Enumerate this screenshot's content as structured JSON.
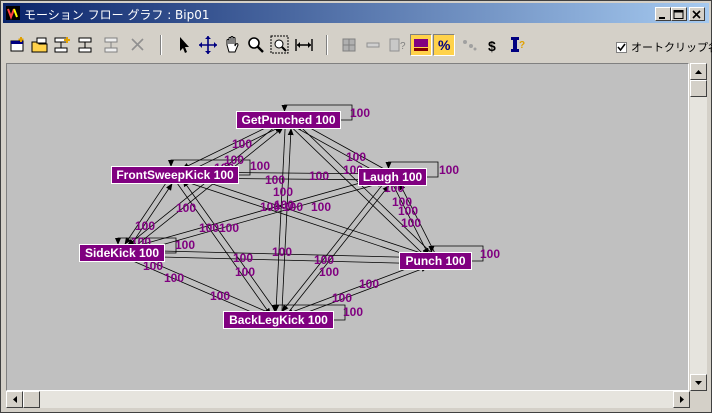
{
  "window": {
    "title": "モーション フロー グラフ : Bip01",
    "controls": [
      "minimize",
      "maximize",
      "close"
    ]
  },
  "toolbar": {
    "left_tools": [
      "add-clip-icon",
      "open-clip-icon",
      "add-transition-icon",
      "edit-transition-icon",
      "delete-transition-icon",
      "delete-icon"
    ],
    "nav_tools": [
      "select-arrow-icon",
      "move-icon",
      "pan-hand-icon",
      "zoom-icon",
      "zoom-region-icon",
      "zoom-extents-icon"
    ],
    "right_tools": [
      "grid-icon",
      "minus-icon",
      "info-icon",
      "show-weights-icon",
      "percent-icon",
      "random-icon",
      "dollar-icon",
      "script-icon"
    ],
    "active_tools": [
      "show-weights-icon",
      "percent-icon"
    ],
    "autoclip_checked": true,
    "autoclip_label": "オートクリップ名"
  },
  "graph": {
    "node_color": "#800080",
    "edge_label_color": "#800080",
    "nodes": [
      {
        "id": "getpunched",
        "label": "GetPunched 100"
      },
      {
        "id": "frontsweepkick",
        "label": "FrontSweepKick 100"
      },
      {
        "id": "laugh",
        "label": "Laugh 100"
      },
      {
        "id": "sidekick",
        "label": "SideKick 100"
      },
      {
        "id": "punch",
        "label": "Punch 100"
      },
      {
        "id": "backlegkick",
        "label": "BackLegKick 100"
      }
    ],
    "edge_labels": [
      "100",
      "100",
      "100",
      "100",
      "100",
      "100",
      "100",
      "100",
      "100",
      "100",
      "100",
      "100",
      "100",
      "100",
      "100",
      "100",
      "100",
      "100",
      "100",
      "100",
      "100",
      "100",
      "100",
      "100",
      "100",
      "100",
      "100",
      "100",
      "100",
      "100",
      "100",
      "100",
      "100",
      "100",
      "100",
      "100",
      "100"
    ]
  }
}
